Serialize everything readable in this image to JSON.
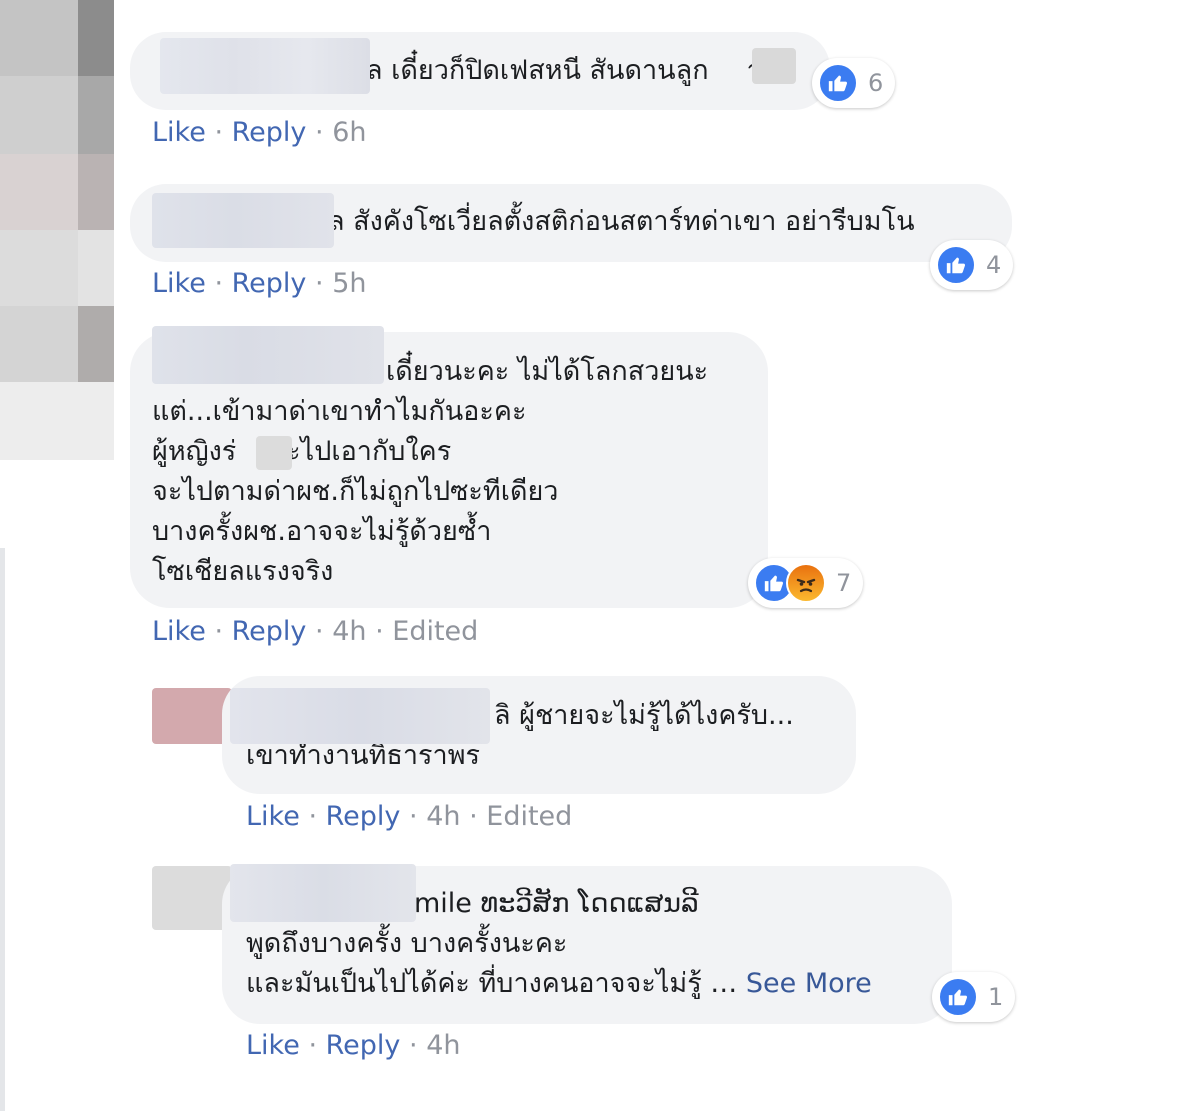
{
  "comments": [
    {
      "text": "ล เดี๋ยวก็ปิดเฟสหนี สันดานลูก",
      "text_tail": "า",
      "actions": {
        "like": "Like",
        "reply": "Reply",
        "time": "6h"
      },
      "reactions": {
        "count": "6"
      }
    },
    {
      "text": "ล สังคังโซเวี่ยลตั้งสติก่อนสตาร์ทด่าเขา อย่ารีบมโน",
      "actions": {
        "like": "Like",
        "reply": "Reply",
        "time": "5h"
      },
      "reactions": {
        "count": "4"
      }
    },
    {
      "lines": [
        "เดี๋ยวนะคะ ไม่ได้โลกสวยนะ",
        "แต่...เข้ามาด่าเขาทำไมกันอะคะ",
        "ผู้หญิงร่",
        "จะไปตามด่าผช.ก็ไม่ถูกไปซะทีเดียว",
        "บางครั้งผช.อาจจะไม่รู้ด้วยซ้ำ",
        "โซเชียลแรงจริง"
      ],
      "line3_tail": "จะไปเอากับใคร",
      "actions": {
        "like": "Like",
        "reply": "Reply",
        "time": "4h",
        "edited": "Edited"
      },
      "reactions": {
        "count": "7"
      }
    }
  ],
  "replies": [
    {
      "lines": [
        "ลิ ผู้ชายจะไม่รู้ได้ไงครับ...",
        "เขาทำงานทิธาราพร"
      ],
      "actions": {
        "like": "Like",
        "reply": "Reply",
        "time": "4h",
        "edited": "Edited"
      }
    },
    {
      "lines": [
        "mile ທະວີສັກ ໂດດແສນລີ",
        "พูดถึงบางครั้ง บางครั้งนะคะ",
        "และมันเป็นไปได้ค่ะ ที่บางคนอาจจะไม่รู้ …"
      ],
      "see_more": "See More",
      "actions": {
        "like": "Like",
        "reply": "Reply",
        "time": "4h"
      },
      "reactions": {
        "count": "1"
      }
    }
  ],
  "separator": "·",
  "colors": {
    "link": "#4267b2",
    "meta": "#90949c",
    "bubble": "#f2f3f5",
    "like": "#3b7cf1"
  }
}
